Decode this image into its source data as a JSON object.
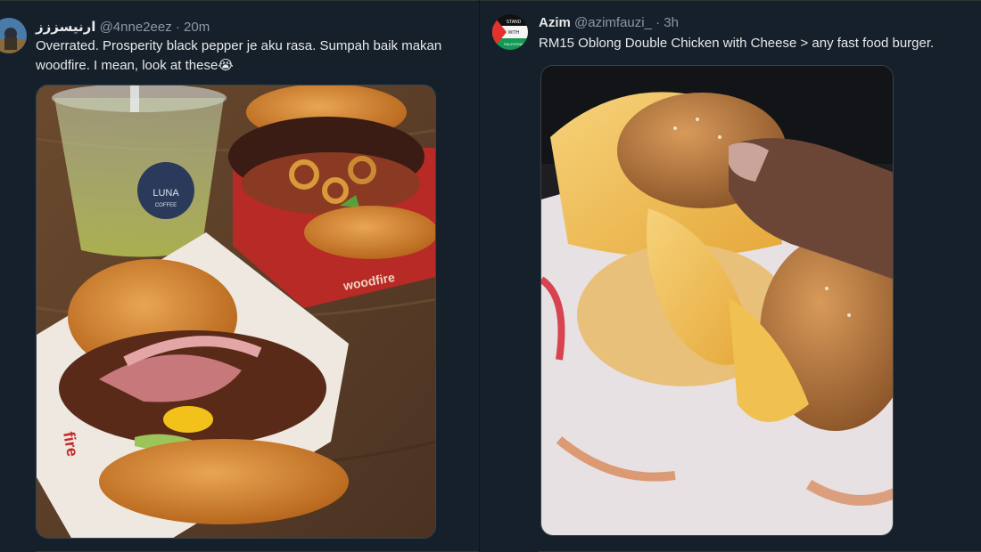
{
  "tweets": [
    {
      "display_name": "ارنيسززز",
      "handle": "@4nne2eez",
      "separator": "·",
      "time": "20m",
      "text_line1": "Overrated. Prosperity black pepper je aku rasa. Sumpah baik makan",
      "text_line2": "woodfire. I mean, look at these",
      "emoji": "😭",
      "media": {
        "cup_logo": "LUNA",
        "cup_logo_sub": "COFFEE",
        "box_brand": "woodfire",
        "box_side": "fire"
      }
    },
    {
      "display_name": "Azim",
      "handle": "@azimfauzi_",
      "separator": "·",
      "time": "3h",
      "text": "RM15 Oblong Double Chicken with Cheese > any fast food burger.",
      "avatar_text_1": "STAND",
      "avatar_text_2": "WITH",
      "avatar_text_3": "PALESTINE"
    }
  ]
}
